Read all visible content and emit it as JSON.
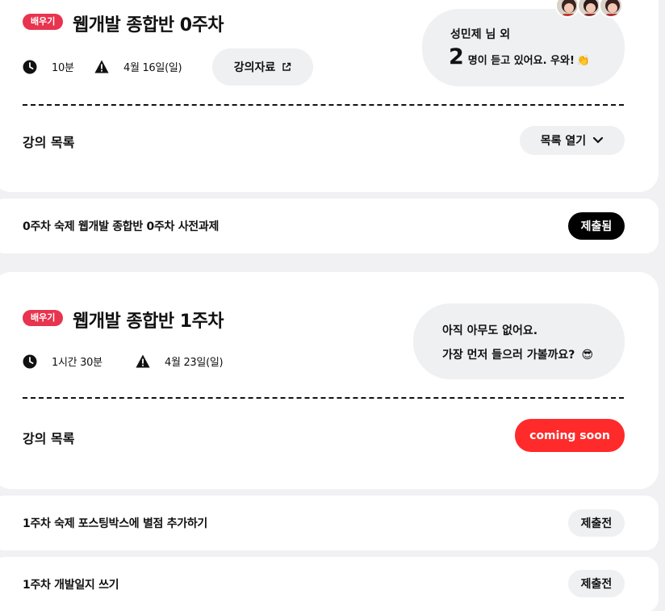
{
  "week0": {
    "tag": "배우기",
    "title": "웹개발 종합반 0주차",
    "duration": "10분",
    "date": "4월 16일(일)",
    "materials_button": "강의자료",
    "listeners_name": "성민제 님 외",
    "listeners_count": "2",
    "listeners_suffix": "명이 듣고 있어요. 우와!",
    "listeners_emoji": "👏",
    "list_label": "강의 목록",
    "list_toggle": "목록 열기"
  },
  "week0_homework": [
    {
      "title": "0주차 숙제 웹개발 종합반 0주차 사전과제",
      "status": "제출됨"
    }
  ],
  "week1": {
    "tag": "배우기",
    "title": "웹개발 종합반 1주차",
    "duration": "1시간 30분",
    "date": "4월 23일(일)",
    "empty_line1": "아직 아무도 없어요.",
    "empty_line2": "가장 먼저 들으러 가볼까요?",
    "empty_emoji": "😎",
    "list_label": "강의 목록",
    "list_status": "coming soon"
  },
  "week1_homework": [
    {
      "title": "1주차 숙제 포스팅박스에 별점 추가하기",
      "status": "제출전"
    },
    {
      "title": "1주차 개발일지 쓰기",
      "status": "제출전"
    }
  ],
  "colors": {
    "tag": "#e8344e",
    "coming_soon": "#ff2a2a",
    "submitted": "#000000",
    "pending": "#eef0f2"
  }
}
